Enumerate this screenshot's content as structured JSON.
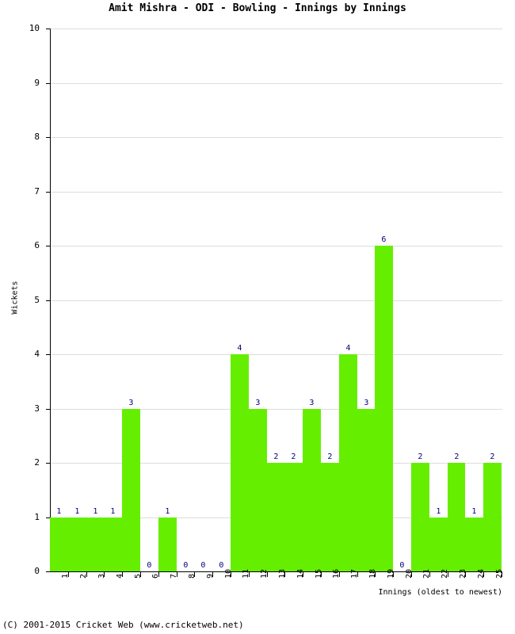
{
  "chart_data": {
    "type": "bar",
    "title": "Amit Mishra - ODI - Bowling - Innings by Innings",
    "xlabel": "Innings (oldest to newest)",
    "ylabel": "Wickets",
    "categories": [
      "1",
      "2",
      "3",
      "4",
      "5",
      "6",
      "7",
      "8",
      "9",
      "10",
      "11",
      "12",
      "13",
      "14",
      "15",
      "16",
      "17",
      "18",
      "19",
      "20",
      "21",
      "22",
      "23",
      "24",
      "25"
    ],
    "values": [
      1,
      1,
      1,
      1,
      3,
      0,
      1,
      0,
      0,
      0,
      4,
      3,
      2,
      2,
      3,
      2,
      4,
      3,
      6,
      0,
      2,
      1,
      2,
      1,
      2
    ],
    "value_labels": [
      "1",
      "1",
      "1",
      "1",
      "3",
      "0",
      "1",
      "0",
      "0",
      "0",
      "4",
      "3",
      "2",
      "2",
      "3",
      "2",
      "4",
      "3",
      "6",
      "0",
      "2",
      "1",
      "2",
      "1",
      "2"
    ],
    "ylim": [
      0,
      10
    ],
    "y_ticks": [
      "0",
      "1",
      "2",
      "3",
      "4",
      "5",
      "6",
      "7",
      "8",
      "9",
      "10"
    ],
    "grid": true,
    "legend": false,
    "bar_color": "#66ee00",
    "label_color": "#00007f",
    "gridline_color": "#dddddd",
    "axis_color": "#000000"
  },
  "footer": {
    "copyright": "(C) 2001-2015 Cricket Web (www.cricketweb.net)"
  }
}
